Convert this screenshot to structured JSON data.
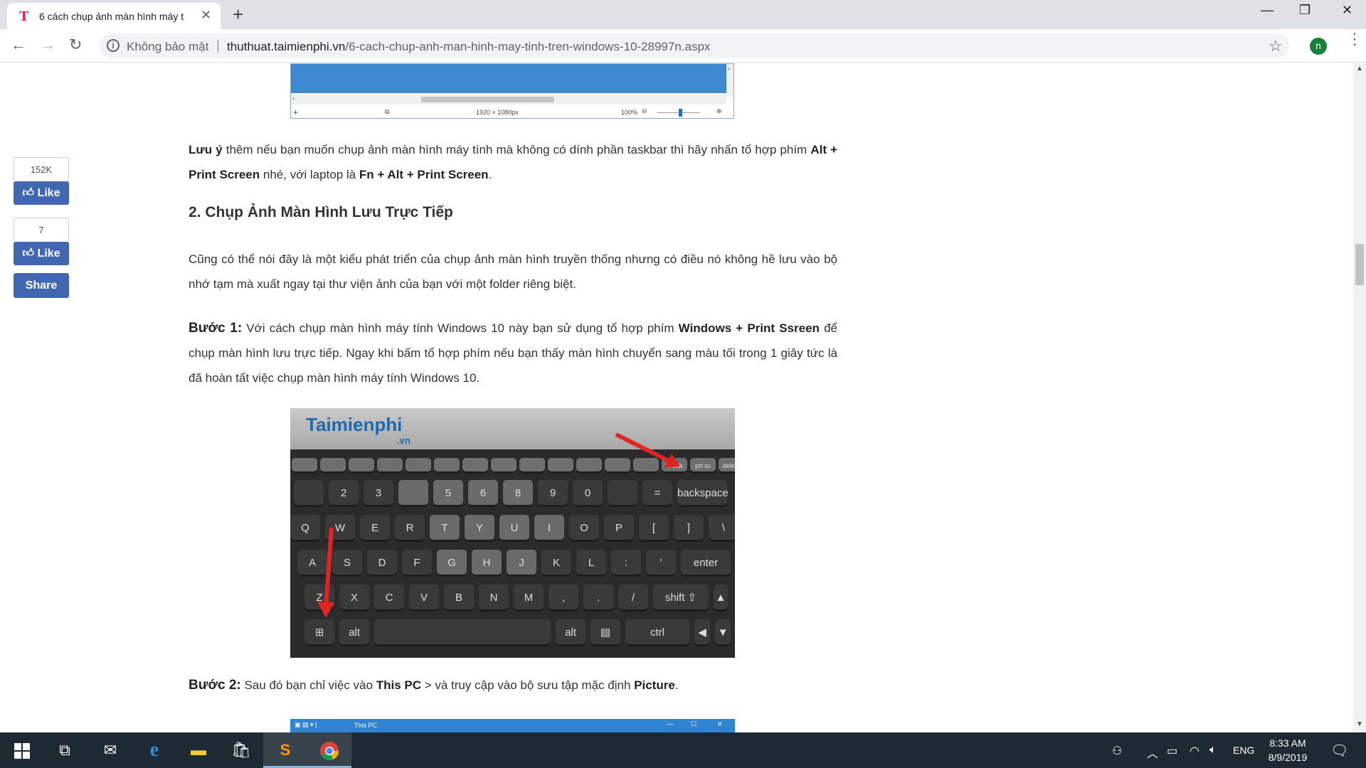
{
  "browser": {
    "tab": {
      "favicon_letter": "T",
      "title": "6 cách chụp ảnh màn hình máy t",
      "close_glyph": "✕"
    },
    "new_tab_glyph": "+",
    "window": {
      "minimize": "—",
      "restore": "❐",
      "close": "✕"
    },
    "nav": {
      "back": "←",
      "forward": "→",
      "reload": "↻"
    },
    "omnibox": {
      "security_label": "Không bảo mật",
      "separator": "|",
      "domain": "thuthuat.taimienphi.vn",
      "path": "/6-cach-chup-anh-man-hinh-may-tinh-tren-windows-10-28997n.aspx"
    },
    "star_glyph": "☆",
    "profile_initial": "n",
    "menu_glyph": "⋮"
  },
  "social": {
    "like1_count": "152K",
    "like_label": "Like",
    "like2_count": "7",
    "share_label": "Share"
  },
  "top_screenshot": {
    "size_label": "1920 × 1080px",
    "zoom_label": "100%"
  },
  "article": {
    "note_bold": "Lưu ý",
    "note_text1": " thêm nếu bạn muốn chụp ảnh màn hình máy tính mà không có dính phần taskbar thì hãy nhấn tổ hợp phím ",
    "note_keys1": "Alt + Print Screen",
    "note_text2": " nhé, với laptop là ",
    "note_keys2": "Fn + Alt + Print Screen",
    "note_text3": ".",
    "heading": "2. Chụp Ảnh Màn Hình Lưu Trực Tiếp",
    "intro": "Cũng có thể nói đây là một kiểu phát triển của chụp ảnh màn hình truyền thống nhưng có điều nó không hề lưu vào bộ nhớ tạm mà xuất ngay tại thư viện ảnh của bạn với một folder riêng biệt.",
    "step1_label": "Bước 1:",
    "step1_text1": " Với cách chụp màn hình máy tính Windows 10 này bạn sử dụng tổ hợp phím ",
    "step1_keys": "Windows + Print Ssreen",
    "step1_text2": " để chụp màn hình lưu trực tiếp. Ngay khi bấm tổ hợp phím nếu bạn thấy màn hình chuyển sang màu tối trong 1 giây tức là đã hoàn tất việc chụp màn hình máy tính Windows 10.",
    "step2_label": "Bước 2:",
    "step2_text1": " Sau đó bạn chỉ việc vào ",
    "step2_pc": "This PC",
    "step2_text2": " > và truy cập vào bộ sưu tập mặc định ",
    "step2_pic": "Picture",
    "step2_text3": "."
  },
  "keyboard_image": {
    "logo": "Taimienphi",
    "logo_sub": ".vn",
    "fn_keys": [
      "",
      "",
      "",
      "",
      "",
      "",
      "",
      "",
      "",
      "",
      "",
      "",
      "",
      "break",
      "prt sc sysrq",
      "delete"
    ],
    "num_keys": [
      "",
      "2",
      "3",
      "",
      "5",
      "6",
      "8",
      "9",
      "0",
      "",
      "=",
      "backspace"
    ],
    "q_keys": [
      "Q",
      "W",
      "E",
      "R",
      "T",
      "Y",
      "U",
      "I",
      "O",
      "P",
      "[",
      "]",
      "\\"
    ],
    "a_keys": [
      "A",
      "S",
      "D",
      "F",
      "G",
      "H",
      "J",
      "K",
      "L",
      ":",
      "'",
      "enter"
    ],
    "z_keys": [
      "Z",
      "X",
      "C",
      "V",
      "B",
      "N",
      "M",
      ",",
      ".",
      "/",
      "shift ⇧",
      "▲"
    ],
    "bottom_keys": [
      "⊞",
      "alt",
      "",
      "alt",
      "▤",
      "ctrl",
      "◀",
      "▼"
    ]
  },
  "bottom_screenshot": {
    "title": "This PC"
  },
  "taskbar": {
    "clock_time": "8:33 AM",
    "clock_date": "8/9/2019",
    "language": "ENG"
  },
  "colors": {
    "facebook_blue": "#4267b2",
    "taskbar_bg": "#1e2a33",
    "favicon": "#e8115f"
  }
}
